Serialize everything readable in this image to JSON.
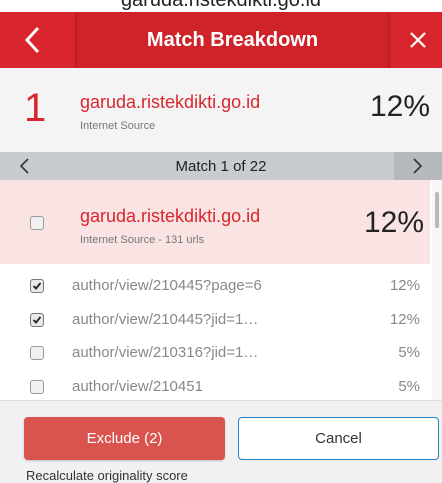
{
  "top_strip": {
    "text": "garuda.ristekdikti.go.id"
  },
  "header": {
    "title": "Match Breakdown",
    "back_icon": "chevron-left-icon",
    "close_icon": "close-icon",
    "color": "#d9262e"
  },
  "source": {
    "rank": "1",
    "name": "garuda.ristekdikti.go.id",
    "type": "Internet Source",
    "percent": "12%"
  },
  "match_nav": {
    "label": "Match 1 of 22",
    "prev_icon": "chevron-left-icon",
    "next_icon": "chevron-right-icon"
  },
  "match": {
    "name": "garuda.ristekdikti.go.id",
    "type": "Internet Source - 131 urls",
    "percent": "12%",
    "checked": false
  },
  "urls": [
    {
      "path": "author/view/210445?page=6",
      "percent": "12%",
      "checked": true
    },
    {
      "path": "author/view/210445?jid=1…",
      "percent": "12%",
      "checked": true
    },
    {
      "path": "author/view/210316?jid=1…",
      "percent": "5%",
      "checked": false
    },
    {
      "path": "author/view/210451",
      "percent": "5%",
      "checked": false
    }
  ],
  "footer": {
    "exclude_label": "Exclude (2)",
    "cancel_label": "Cancel",
    "recalc_label": "Recalculate originality score",
    "exclude_color": "#d9534f",
    "cancel_border_color": "#2a80c1"
  }
}
